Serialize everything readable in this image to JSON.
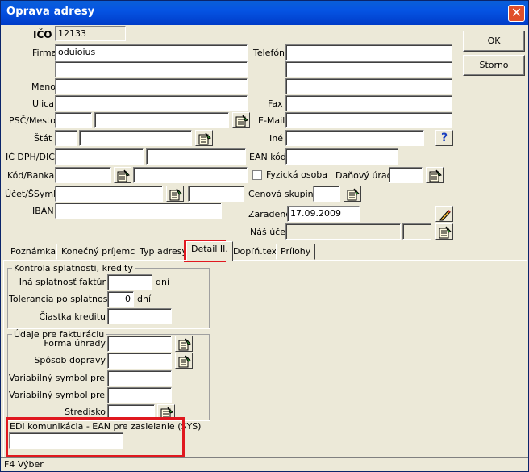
{
  "window": {
    "title": "Oprava adresy",
    "close_symbol": "✕"
  },
  "buttons": {
    "ok": "OK",
    "cancel": "Storno",
    "help": "?"
  },
  "fields": {
    "ico": {
      "label": "IČO",
      "value": "12133"
    },
    "firma": {
      "label": "Firma",
      "value": "oduioius"
    },
    "meno": {
      "label": "Meno"
    },
    "ulica": {
      "label": "Ulica"
    },
    "psc": {
      "label": "PSČ/Mesto"
    },
    "stat": {
      "label": "Štát"
    },
    "icdph": {
      "label": "IČ DPH/DIČ"
    },
    "kodbanka": {
      "label": "Kód/Banka"
    },
    "ucet": {
      "label": "Účet/ŠSymb"
    },
    "iban": {
      "label": "IBAN"
    },
    "telefon": {
      "label": "Telefón"
    },
    "fax": {
      "label": "Fax"
    },
    "email": {
      "label": "E-Mail"
    },
    "ine": {
      "label": "Iné"
    },
    "ean": {
      "label": "EAN kód"
    },
    "fyzicka": {
      "label": "Fyzická osoba"
    },
    "danovy": {
      "label": "Daňový úrad"
    },
    "cenova": {
      "label": "Cenová skupina"
    },
    "zaradene": {
      "label": "Zaradené",
      "value": "17.09.2009"
    },
    "nas_ucet": {
      "label": "Náš účet"
    }
  },
  "tabs": [
    "Poznámka",
    "Konečný príjemca",
    "Typ adresy",
    "Detail II.",
    "Dopľň.text",
    "Prílohy"
  ],
  "active_tab": "Detail II.",
  "kontrola": {
    "title": "Kontrola splatnosti, kredity",
    "ina_splatnost": "Iná splatnosť faktúr",
    "ina_unit": "dní",
    "tolerancia": "Tolerancia po splatnosti",
    "tolerancia_value": "0",
    "tolerancia_unit": "dní",
    "ciastka": "Čiastka kreditu"
  },
  "udaje": {
    "title": "Údaje pre fakturáciu",
    "forma": "Forma úhrady",
    "sposob": "Spôsob dopravy",
    "vs_fv": "Variabilný symbol pre FV",
    "vs_fp": "Variabilný symbol pre FP",
    "stredisko": "Stredisko"
  },
  "edi": {
    "label": "EDI komunikácia - EAN pre zasielanie (SYS)"
  },
  "status": "F4 Výber",
  "colors": {
    "titlebar": "#0554e3",
    "highlight": "#e0181f",
    "dialog": "#ece9d8"
  }
}
